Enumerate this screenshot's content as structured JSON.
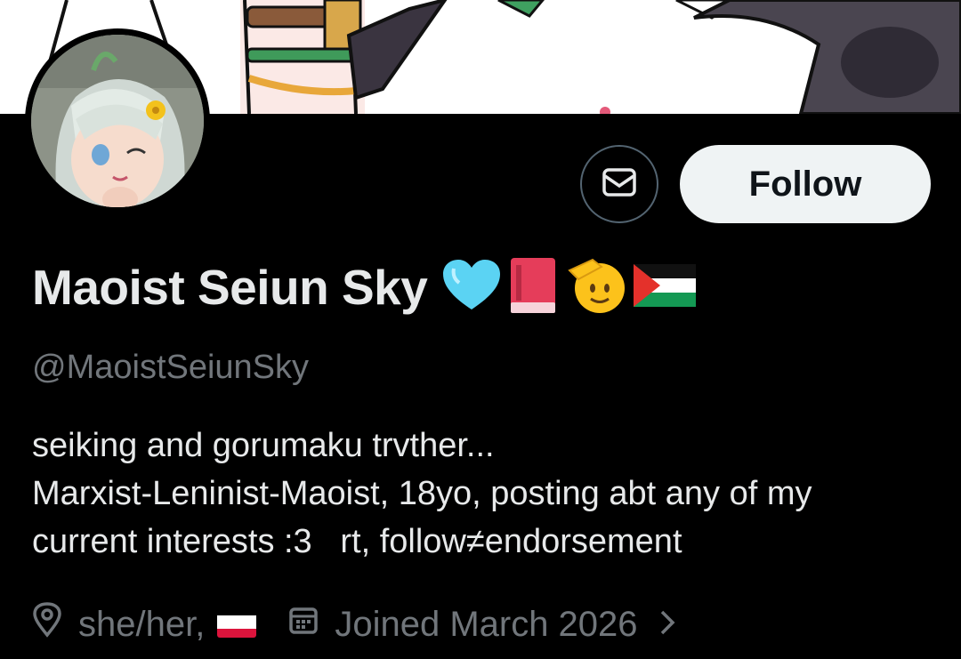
{
  "profile": {
    "display_name": "Maoist Seiun Sky",
    "name_emojis": [
      "light-blue-heart",
      "red-book",
      "saluting-face",
      "palestine-flag"
    ],
    "handle": "@MaoistSeiunSky",
    "bio_lines": [
      "seiking and gorumaku trvther...",
      "Marxist-Leninist-Maoist, 18yo, posting abt any of my",
      "current interests :3   rt, follow≠endorsement"
    ],
    "location": "she/her,",
    "location_flag": "poland-flag",
    "joined": "Joined March 2026"
  },
  "actions": {
    "follow_label": "Follow",
    "message_icon": "envelope-icon"
  },
  "colors": {
    "background": "#000000",
    "primary_text": "#e7e9ea",
    "secondary_text": "#71767b",
    "follow_bg": "#eff3f4",
    "button_border": "#536471"
  }
}
